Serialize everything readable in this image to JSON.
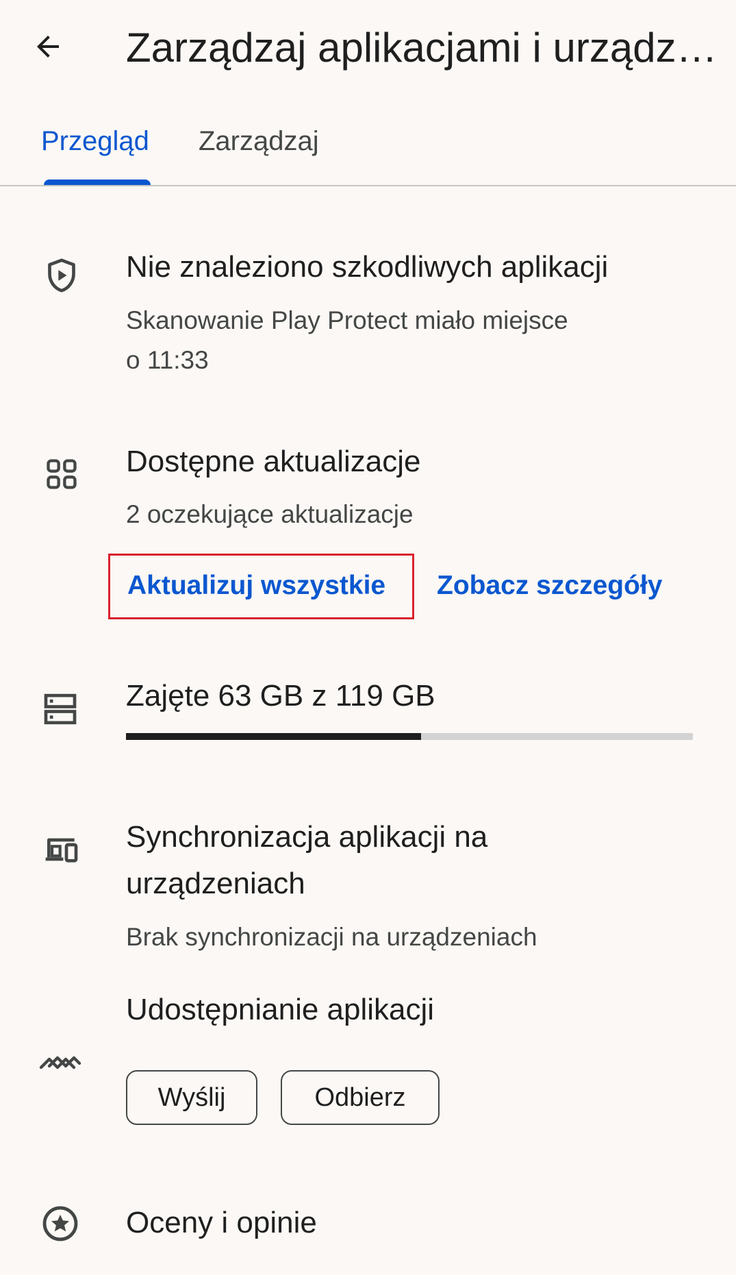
{
  "header": {
    "title": "Zarządzaj aplikacjami i urządzeniem",
    "back_icon": "arrow-back-icon"
  },
  "tabs": [
    {
      "label": "Przegląd",
      "active": true
    },
    {
      "label": "Zarządzaj",
      "active": false
    }
  ],
  "protect": {
    "icon": "shield-play-icon",
    "title": "Nie znaleziono szkodliwych aplikacji",
    "subtitle_line1": "Skanowanie Play Protect miało miejsce",
    "subtitle_line2": "o 11:33"
  },
  "updates": {
    "icon": "apps-grid-icon",
    "title": "Dostępne aktualizacje",
    "subtitle": "2 oczekujące aktualizacje",
    "update_all_label": "Aktualizuj wszystkie",
    "details_label": "Zobacz szczegóły"
  },
  "storage": {
    "icon": "storage-icon",
    "title": "Zajęte 63 GB z 119 GB",
    "used_fraction": 0.52
  },
  "sync": {
    "icon": "devices-icon",
    "title_line1": "Synchronizacja aplikacji na",
    "title_line2": "urządzeniach",
    "subtitle": "Brak synchronizacji na urządzeniach"
  },
  "sharing": {
    "icon": "nearby-share-icon",
    "title": "Udostępnianie aplikacji",
    "send_label": "Wyślij",
    "receive_label": "Odbierz"
  },
  "ratings": {
    "icon": "star-circle-icon",
    "title": "Oceny i opinie"
  },
  "colors": {
    "accent": "#0b57d0",
    "highlight_border": "#d9232e",
    "background": "#fbf8f5"
  }
}
